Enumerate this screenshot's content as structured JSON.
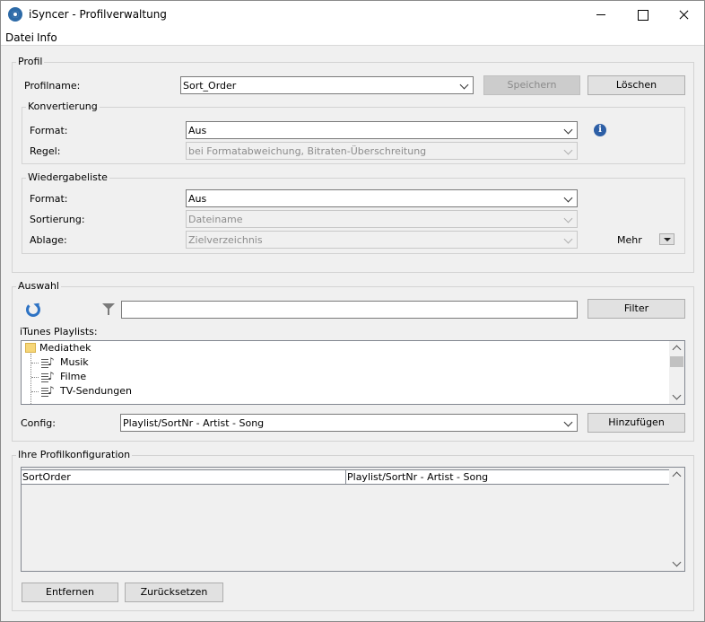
{
  "window": {
    "title": "iSyncer - Profilverwaltung"
  },
  "menu": {
    "items": [
      "Datei",
      "Info"
    ]
  },
  "profil": {
    "group_label": "Profil",
    "profilname_label": "Profilname:",
    "profilname_value": "Sort_Order",
    "save_label": "Speichern",
    "delete_label": "Löschen",
    "konvertierung": {
      "group_label": "Konvertierung",
      "format_label": "Format:",
      "format_value": "Aus",
      "regel_label": "Regel:",
      "regel_value": "bei Formatabweichung, Bitraten-Überschreitung"
    },
    "wiedergabeliste": {
      "group_label": "Wiedergabeliste",
      "format_label": "Format:",
      "format_value": "Aus",
      "sortierung_label": "Sortierung:",
      "sortierung_value": "Dateiname",
      "ablage_label": "Ablage:",
      "ablage_value": "Zielverzeichnis",
      "mehr_label": "Mehr"
    }
  },
  "auswahl": {
    "group_label": "Auswahl",
    "filter_value": "",
    "filter_button": "Filter",
    "playlists_label": "iTunes Playlists:",
    "tree": {
      "root": "Mediathek",
      "children": [
        "Musik",
        "Filme",
        "TV-Sendungen"
      ]
    },
    "config_label": "Config:",
    "config_value": "Playlist/SortNr - Artist - Song",
    "add_label": "Hinzufügen"
  },
  "profilkonfiguration": {
    "group_label": "Ihre Profilkonfiguration",
    "rows": [
      {
        "name": "SortOrder",
        "config": "Playlist/SortNr - Artist - Song"
      }
    ],
    "remove_label": "Entfernen",
    "reset_label": "Zurücksetzen"
  }
}
